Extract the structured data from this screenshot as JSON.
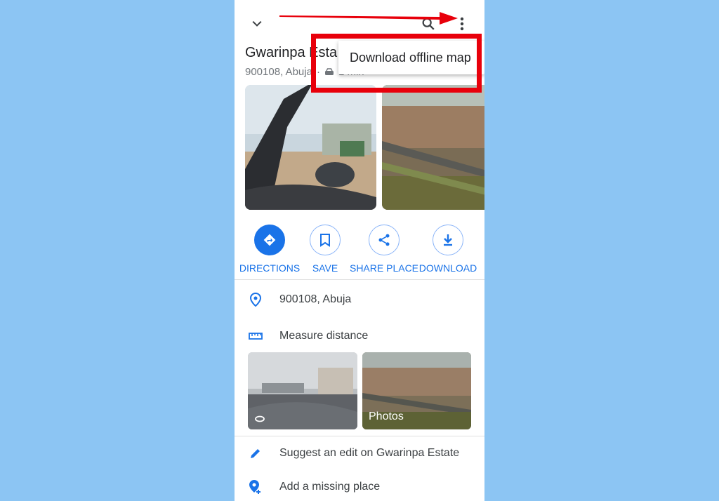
{
  "header": {
    "collapse_icon": "chevron-down-icon",
    "search_icon": "search-icon",
    "more_icon": "more-vert-icon"
  },
  "menu": {
    "download_offline_map": "Download offline map"
  },
  "place": {
    "title": "Gwarinpa Esta",
    "subtitle_address": "900108, Abuja",
    "subtitle_separator": "·",
    "subtitle_travel": "1 min"
  },
  "actions": [
    {
      "label": "DIRECTIONS",
      "icon": "directions-icon"
    },
    {
      "label": "SAVE",
      "icon": "bookmark-icon"
    },
    {
      "label": "SHARE PLACE",
      "icon": "share-icon"
    },
    {
      "label": "DOWNLOAD",
      "icon": "download-icon"
    }
  ],
  "details": {
    "address": "900108, Abuja",
    "measure": "Measure distance",
    "suggest_edit": "Suggest an edit on Gwarinpa Estate",
    "add_place": "Add a missing place"
  },
  "thumbnails": {
    "photos_label": "Photos"
  },
  "colors": {
    "accent": "#1a73e8",
    "highlight": "#e8000b",
    "background": "#8cc5f3"
  }
}
